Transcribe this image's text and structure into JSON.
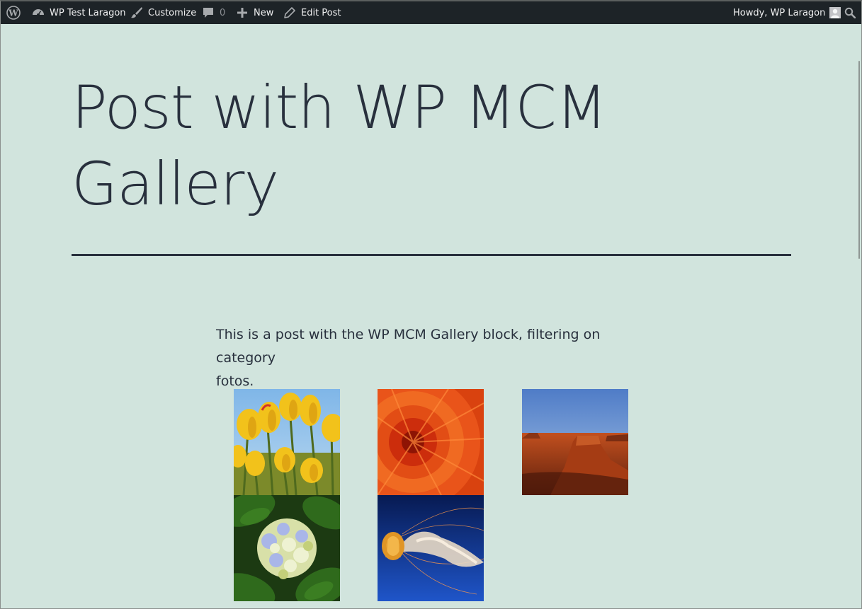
{
  "adminbar": {
    "site_name": "WP Test Laragon",
    "customize_label": "Customize",
    "comments_count": "0",
    "new_label": "New",
    "edit_label": "Edit Post",
    "howdy_label": "Howdy, WP Laragon",
    "icons": {
      "wp_logo": "wordpress-logo-icon",
      "site": "dashboard-icon",
      "customize": "paintbrush-icon",
      "comments": "comment-bubble-icon",
      "new": "plus-icon",
      "edit": "pencil-icon",
      "avatar": "avatar-icon",
      "search": "search-icon"
    },
    "colors": {
      "background": "#1d2327",
      "text": "#f0f0f1",
      "muted": "#8c8f94"
    }
  },
  "post": {
    "title_line1": "Post with WP MCM",
    "title_line2": "Gallery",
    "intro_line1": "This is a post with the WP MCM Gallery block, filtering on category",
    "intro_line2": "fotos.",
    "colors": {
      "background": "#d1e4dd",
      "text": "#28303d"
    }
  },
  "gallery": {
    "images": [
      {
        "subject": "yellow tulips"
      },
      {
        "subject": "orange chrysanthemum"
      },
      {
        "subject": "desert butte"
      },
      {
        "subject": "hydrangea"
      },
      {
        "subject": "jellyfish"
      }
    ]
  }
}
